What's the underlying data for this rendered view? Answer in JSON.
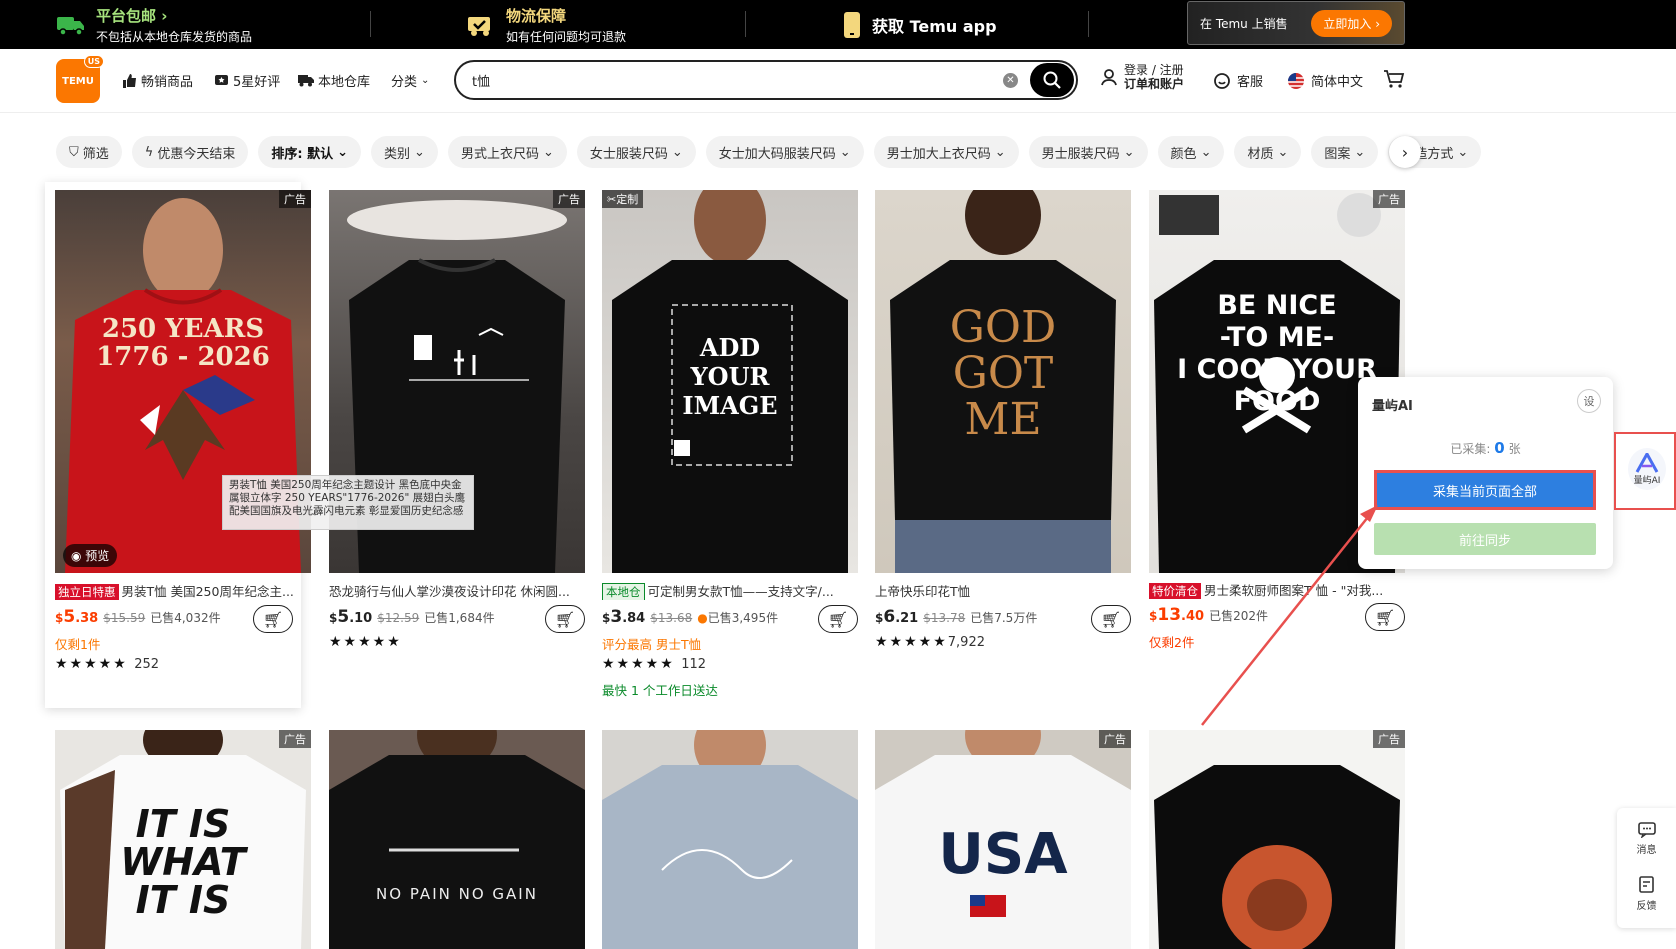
{
  "topbar": {
    "shipping_title": "平台包邮 ›",
    "shipping_sub": "不包括从本地仓库发货的商品",
    "logistics_title": "物流保障",
    "logistics_sub": "如有任何问题均可退款",
    "app_label": "获取 Temu app",
    "sell_label": "在 Temu 上销售",
    "join_label": "立即加入 ›"
  },
  "header": {
    "logo_text": "TEMU",
    "logo_badge": "US",
    "nav": [
      "畅销商品",
      "5星好评",
      "本地仓库",
      "分类"
    ],
    "search_value": "t恤",
    "login_line1": "登录 / 注册",
    "login_line2": "订单和账户",
    "service": "客服",
    "language": "简体中文"
  },
  "filters": [
    "筛选",
    "优惠今天结束",
    "排序: 默认",
    "类别",
    "男式上衣尺码",
    "女士服装尺码",
    "女士加大码服装尺码",
    "男士加大上衣尺码",
    "男士服装尺码",
    "颜色",
    "材质",
    "图案",
    "织造方式"
  ],
  "products": [
    {
      "tag": "广告",
      "badge": "独立日特惠",
      "title": "男装T恤 美国250周年纪念主...",
      "price_sym": "$",
      "price_int": "5",
      "price_dec": ".38",
      "orig": "$15.59",
      "sold": "已售4,032件",
      "extra": "仅剩1件",
      "stars": "★★★★★",
      "count": "252",
      "preview": "预览",
      "img_text": "250 YEARS\n1776 - 2026"
    },
    {
      "tag": "广告",
      "badge": "",
      "title": "恐龙骑行与仙人掌沙漠夜设计印花 休闲圆...",
      "price_sym": "$",
      "price_int": "5",
      "price_dec": ".10",
      "orig": "$12.59",
      "sold": "已售1,684件",
      "extra": "",
      "stars": "★★★★★",
      "count": ""
    },
    {
      "tag": "定制",
      "badge": "本地仓",
      "title": "可定制男女款T恤——支持文字/...",
      "price_sym": "$",
      "price_int": "3",
      "price_dec": ".84",
      "orig": "$13.68",
      "sold": "已售3,495件",
      "extra": "评分最高 男士T恤",
      "stars": "★★★★★",
      "count": "112",
      "delivery": "最快 1 个工作日送达",
      "img_text": "ADD\nYOUR\nIMAGE"
    },
    {
      "tag": "",
      "badge": "",
      "title": "上帝快乐印花T恤",
      "price_sym": "$",
      "price_int": "6",
      "price_dec": ".21",
      "orig": "$13.78",
      "sold": "已售7.5万件",
      "extra": "",
      "stars": "★★★★★",
      "count": "7,922",
      "img_text": "GOD\nGOT\nME"
    },
    {
      "tag": "广告",
      "badge": "特价清仓",
      "title": "男士柔软厨师图案T 恤 - \"对我...",
      "price_sym": "$",
      "price_int": "13",
      "price_dec": ".40",
      "orig": "",
      "sold": "已售202件",
      "extra": "仅剩2件",
      "stars": "",
      "count": "",
      "img_text": "BE NICE\n-TO ME-\nI COOK YOUR\nFOOD"
    }
  ],
  "row2": [
    {
      "tag": "广告",
      "img_text": "IT IS\nWHAT\nIT IS"
    },
    {
      "tag": "",
      "img_text": "NO PAIN NO GAIN"
    },
    {
      "tag": "",
      "img_text": ""
    },
    {
      "tag": "广告",
      "img_text": "USA"
    },
    {
      "tag": "广告",
      "img_text": ""
    }
  ],
  "tooltip": "男装T恤 美国250周年纪念主题设计 黑色底中央金属银立体字 250 YEARS\"1776-2026\" 展翅白头鹰配美国国旗及电光霹闪电元素 彰显爱国历史纪念感",
  "panel": {
    "title": "量屿AI",
    "settings": "设",
    "count_label": "已采集:",
    "count_value": "0",
    "count_unit": "张",
    "collect_button": "采集当前页面全部",
    "sync_button": "前往同步"
  },
  "float_logo": "量屿AI",
  "side_tools": [
    "消息",
    "反馈"
  ],
  "colors": {
    "accent": "#fb7701",
    "price_red": "#fb3d00",
    "panel_blue": "#2d7fe0",
    "highlight_red": "#e8504e",
    "delivery_green": "#0a8a2a"
  }
}
